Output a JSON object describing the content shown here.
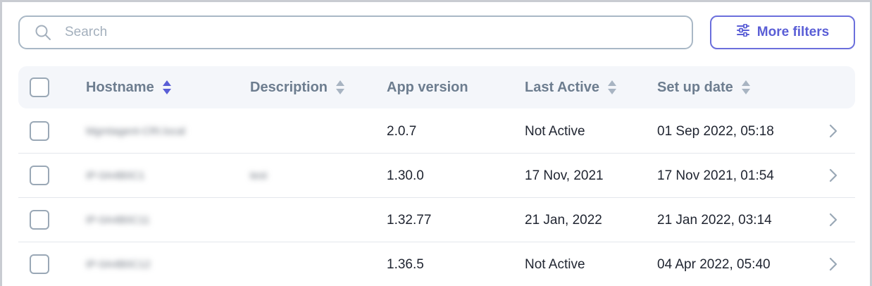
{
  "search": {
    "placeholder": "Search",
    "value": ""
  },
  "toolbar": {
    "more_filters_label": "More filters"
  },
  "colors": {
    "accent": "#5a5ed6",
    "border": "#a9b8c6",
    "header_bg": "#f4f6fa",
    "header_text": "#6d7d8f"
  },
  "table": {
    "columns": [
      {
        "label": "Hostname",
        "sortable": true,
        "active": true
      },
      {
        "label": "Description",
        "sortable": true,
        "active": false
      },
      {
        "label": "App version",
        "sortable": false,
        "active": false
      },
      {
        "label": "Last Active",
        "sortable": true,
        "active": false
      },
      {
        "label": "Set up date",
        "sortable": true,
        "active": false
      }
    ],
    "rows": [
      {
        "hostname": "Mgmtagent-CRI.local",
        "description": "",
        "app_version": "2.0.7",
        "last_active": "Not Active",
        "setup_date": "01 Sep 2022, 05:18"
      },
      {
        "hostname": "IP-0A4B0C1",
        "description": "test",
        "app_version": "1.30.0",
        "last_active": "17 Nov, 2021",
        "setup_date": "17 Nov 2021, 01:54"
      },
      {
        "hostname": "IP-0A4B0C11",
        "description": "",
        "app_version": "1.32.77",
        "last_active": "21 Jan, 2022",
        "setup_date": "21 Jan 2022, 03:14"
      },
      {
        "hostname": "IP-0A4B0C12",
        "description": "",
        "app_version": "1.36.5",
        "last_active": "Not Active",
        "setup_date": "04 Apr 2022, 05:40"
      }
    ]
  }
}
